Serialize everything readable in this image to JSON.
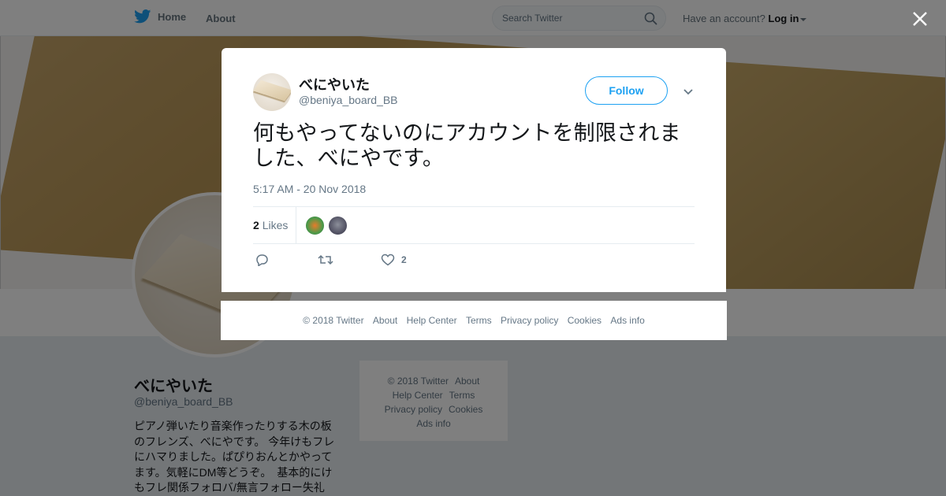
{
  "nav": {
    "home_label": "Home",
    "about_label": "About",
    "search_placeholder": "Search Twitter",
    "account_prompt": "Have an account?",
    "login_label": "Log in"
  },
  "profile": {
    "name": "べにやいた",
    "handle": "@beniya_board_BB",
    "bio": "ピアノ弾いたり音楽作ったりする木の板のフレンズ、べにやです。 今年けもフレにハマりました。ぱぴりおんとかやってます。気軽にDM等どうぞ。　基本的にけもフレ関係フォロバ/無言フォロー失礼"
  },
  "side_footer": {
    "items": [
      "© 2018 Twitter",
      "About",
      "Help Center",
      "Terms",
      "Privacy policy",
      "Cookies",
      "Ads info"
    ]
  },
  "tweet": {
    "author_name": "べにやいた",
    "author_handle": "@beniya_board_BB",
    "follow_label": "Follow",
    "text": "何もやってないのにアカウントを制限されました、べにやです。",
    "timestamp": "5:17 AM - 20 Nov 2018",
    "likes_count": "2",
    "likes_label": "Likes",
    "like_action_count": "2"
  },
  "modal_footer": {
    "items": [
      "© 2018 Twitter",
      "About",
      "Help Center",
      "Terms",
      "Privacy policy",
      "Cookies",
      "Ads info"
    ]
  },
  "colors": {
    "accent": "#1da1f2",
    "muted_text": "#657786",
    "overlay": "rgba(0,0,0,0.5)"
  },
  "icons": {
    "logo": "twitter-bird-icon",
    "search": "search-icon",
    "close": "close-icon",
    "more": "chevron-down-icon",
    "reply": "reply-icon",
    "retweet": "retweet-icon",
    "like": "heart-icon"
  }
}
